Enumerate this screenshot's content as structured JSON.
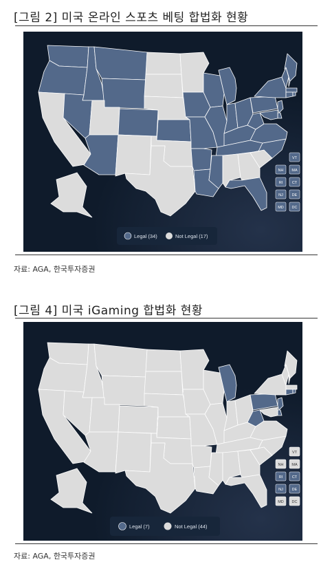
{
  "figures": [
    {
      "title": "[그림 2] 미국 온라인 스포츠 베팅 합법화 현황",
      "source": "자료: AGA, 한국투자증권",
      "legend": {
        "legal": "Legal (34)",
        "not_legal": "Not Legal (17)"
      },
      "small_states": [
        {
          "code": "VT",
          "status": "legal"
        },
        {
          "code": "NH",
          "status": "legal"
        },
        {
          "code": "MA",
          "status": "legal"
        },
        {
          "code": "RI",
          "status": "legal"
        },
        {
          "code": "CT",
          "status": "legal"
        },
        {
          "code": "NJ",
          "status": "legal"
        },
        {
          "code": "DE",
          "status": "legal"
        },
        {
          "code": "MD",
          "status": "legal"
        },
        {
          "code": "DC",
          "status": "legal"
        }
      ]
    },
    {
      "title": "[그림 4] 미국 iGaming 합법화 현황",
      "source": "자료: AGA, 한국투자증권",
      "legend": {
        "legal": "Legal (7)",
        "not_legal": "Not Legal (44)"
      },
      "small_states": [
        {
          "code": "VT",
          "status": "not_legal"
        },
        {
          "code": "NH",
          "status": "not_legal"
        },
        {
          "code": "MA",
          "status": "not_legal"
        },
        {
          "code": "RI",
          "status": "legal"
        },
        {
          "code": "CT",
          "status": "legal"
        },
        {
          "code": "NJ",
          "status": "legal"
        },
        {
          "code": "DE",
          "status": "legal"
        },
        {
          "code": "MD",
          "status": "not_legal"
        },
        {
          "code": "DC",
          "status": "not_legal"
        }
      ]
    }
  ],
  "colors": {
    "legal": "#53698a",
    "not_legal": "#dcdcdc",
    "panel_bg": "#0f1b2b",
    "legend_bg": "#17263a",
    "state_border": "#ffffff"
  }
}
